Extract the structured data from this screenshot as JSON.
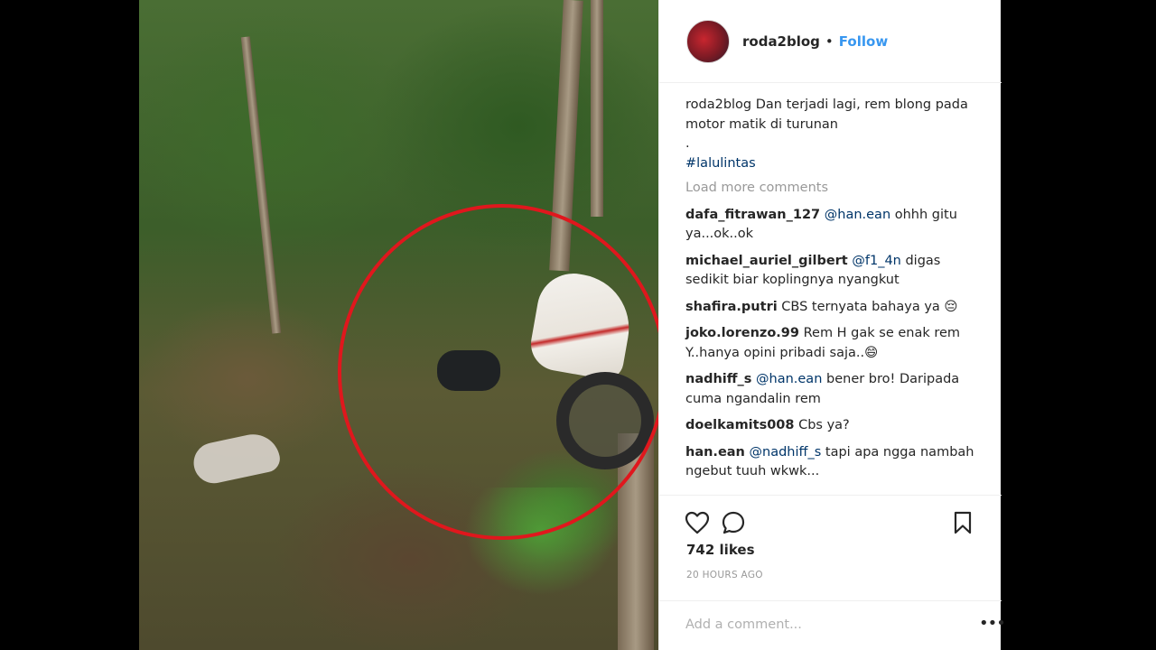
{
  "post": {
    "username": "roda2blog",
    "follow_label": "Follow",
    "separator": "•",
    "avatar_icon": "profile-avatar"
  },
  "caption": {
    "username": "roda2blog",
    "text": "Dan terjadi lagi, rem blong pada motor matik di turunan",
    "dot_line": ".",
    "hashtag": "#lalulintas"
  },
  "load_more": "Load more comments",
  "comments": [
    {
      "username": "dafa_fitrawan_127",
      "mention": "@han.ean",
      "text": "ohhh gitu ya...ok..ok"
    },
    {
      "username": "michael_auriel_gilbert",
      "mention": "@f1_4n",
      "text": "digas sedikit biar koplingnya nyangkut"
    },
    {
      "username": "shafira.putri",
      "mention": "",
      "text": "CBS ternyata bahaya ya 😔"
    },
    {
      "username": "joko.lorenzo.99",
      "mention": "",
      "text": "Rem H gak se enak rem Y..hanya opini pribadi saja..😄"
    },
    {
      "username": "nadhiff_s",
      "mention": "@han.ean",
      "text": "bener bro! Daripada cuma ngandalin rem"
    },
    {
      "username": "doelkamits008",
      "mention": "",
      "text": "Cbs ya?"
    },
    {
      "username": "han.ean",
      "mention": "@nadhiff_s",
      "text": "tapi apa ngga nambah ngebut tuuh wkwk..."
    }
  ],
  "actions": {
    "like_icon": "heart-icon",
    "comment_icon": "comment-icon",
    "save_icon": "bookmark-icon"
  },
  "likes": "742 likes",
  "timestamp": "20 HOURS AGO",
  "add_comment": {
    "placeholder": "Add a comment...",
    "more_label": "•••"
  }
}
